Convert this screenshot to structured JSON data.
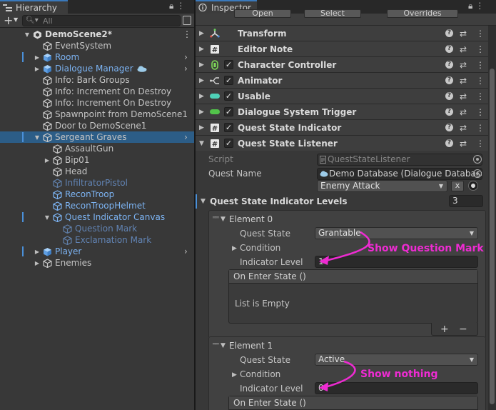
{
  "hierarchy": {
    "tab_label": "Hierarchy",
    "search_placeholder": "All",
    "rows": [
      {
        "label": "DemoScene2*",
        "style": "white",
        "icon": "unity-scene-icon",
        "depth": 0,
        "fold": "open",
        "kebab": true
      },
      {
        "label": "EventSystem",
        "style": "normal",
        "icon": "gameobject-icon",
        "depth": 1
      },
      {
        "label": "Room",
        "style": "blue",
        "icon": "prefab-icon",
        "depth": 1,
        "fold": "closed",
        "chevron": true,
        "bar": true
      },
      {
        "label": "Dialogue Manager",
        "style": "blue",
        "icon": "prefab-icon",
        "depth": 1,
        "fold": "closed",
        "chevron": true,
        "cloud": true
      },
      {
        "label": "Info: Bark Groups",
        "style": "normal",
        "icon": "gameobject-icon",
        "depth": 1
      },
      {
        "label": "Info: Increment On Destroy",
        "style": "normal",
        "icon": "gameobject-icon",
        "depth": 1
      },
      {
        "label": "Info: Increment On Destroy",
        "style": "normal",
        "icon": "gameobject-icon",
        "depth": 1
      },
      {
        "label": "Spawnpoint from DemoScene1",
        "style": "normal",
        "icon": "gameobject-icon",
        "depth": 1
      },
      {
        "label": "Door to DemoScene1",
        "style": "normal",
        "icon": "gameobject-icon",
        "depth": 1
      },
      {
        "label": "Sergeant Graves",
        "style": "normal",
        "icon": "gameobject-icon",
        "depth": 1,
        "fold": "open",
        "chevron": true,
        "selected": true,
        "bar": true
      },
      {
        "label": "AssaultGun",
        "style": "normal",
        "icon": "gameobject-icon",
        "depth": 2
      },
      {
        "label": "Bip01",
        "style": "normal",
        "icon": "gameobject-icon",
        "depth": 2,
        "fold": "closed"
      },
      {
        "label": "Head",
        "style": "normal",
        "icon": "gameobject-icon",
        "depth": 2
      },
      {
        "label": "InfiltratorPistol",
        "style": "dim",
        "icon": "gameobject-icon",
        "depth": 2
      },
      {
        "label": "ReconTroop",
        "style": "blue",
        "icon": "gameobject-icon",
        "depth": 2
      },
      {
        "label": "ReconTroopHelmet",
        "style": "blue",
        "icon": "gameobject-icon",
        "depth": 2
      },
      {
        "label": "Quest Indicator Canvas",
        "style": "blue",
        "icon": "gameobject-icon",
        "depth": 2,
        "fold": "open",
        "bar": true
      },
      {
        "label": "Question Mark",
        "style": "dim",
        "icon": "gameobject-icon",
        "depth": 3
      },
      {
        "label": "Exclamation Mark",
        "style": "dim",
        "icon": "gameobject-icon",
        "depth": 3
      },
      {
        "label": "Player",
        "style": "blue",
        "icon": "prefab-icon",
        "depth": 1,
        "fold": "closed",
        "chevron": true,
        "bar": true
      },
      {
        "label": "Enemies",
        "style": "normal",
        "icon": "gameobject-icon",
        "depth": 1,
        "fold": "closed"
      }
    ]
  },
  "inspector": {
    "tab_label": "Inspector",
    "prefab_buttons": [
      "Open",
      "Select",
      "Overrides"
    ],
    "components": [
      {
        "name": "Transform",
        "icon": "transform-icon",
        "checkbox": false
      },
      {
        "name": "Editor Note",
        "icon": "script-icon",
        "checkbox": false
      },
      {
        "name": "Character Controller",
        "icon": "character-controller-icon",
        "checkbox": true
      },
      {
        "name": "Animator",
        "icon": "animator-icon",
        "checkbox": true
      },
      {
        "name": "Usable",
        "icon": "usable-icon",
        "checkbox": true
      },
      {
        "name": "Dialogue System Trigger",
        "icon": "trigger-icon",
        "checkbox": true
      },
      {
        "name": "Quest State Indicator",
        "icon": "script-icon",
        "checkbox": true
      },
      {
        "name": "Quest State Listener",
        "icon": "script-icon",
        "checkbox": true,
        "expanded": true
      }
    ],
    "listener": {
      "script_label": "Script",
      "script_value": "QuestStateListener",
      "quest_name_label": "Quest Name",
      "quest_db_value": "Demo Database (Dialogue Database",
      "quest_value": "Enemy Attack",
      "x_label": "x",
      "levels_label": "Quest State Indicator Levels",
      "levels_count": "3",
      "elements": [
        {
          "title": "Element 0",
          "quest_state_label": "Quest State",
          "quest_state_value": "Grantable",
          "condition_label": "Condition",
          "indicator_level_label": "Indicator Level",
          "indicator_level_value": "1",
          "on_enter_label": "On Enter State ()",
          "list_empty": "List is Empty",
          "plus": "+",
          "minus": "−"
        },
        {
          "title": "Element 1",
          "quest_state_label": "Quest State",
          "quest_state_value": "Active",
          "condition_label": "Condition",
          "indicator_level_label": "Indicator Level",
          "indicator_level_value": "0",
          "on_enter_label": "On Enter State ()"
        }
      ]
    },
    "annotations": [
      {
        "text": "Show Question Mark",
        "color": "#ee2bd2"
      },
      {
        "text": "Show nothing",
        "color": "#ee2bd2"
      }
    ]
  },
  "colors": {
    "selection": "#2c5d87",
    "accent_blue": "#4a90d9",
    "prefab_blue": "#7cb3f2",
    "annotation_magenta": "#ee2bd2"
  }
}
